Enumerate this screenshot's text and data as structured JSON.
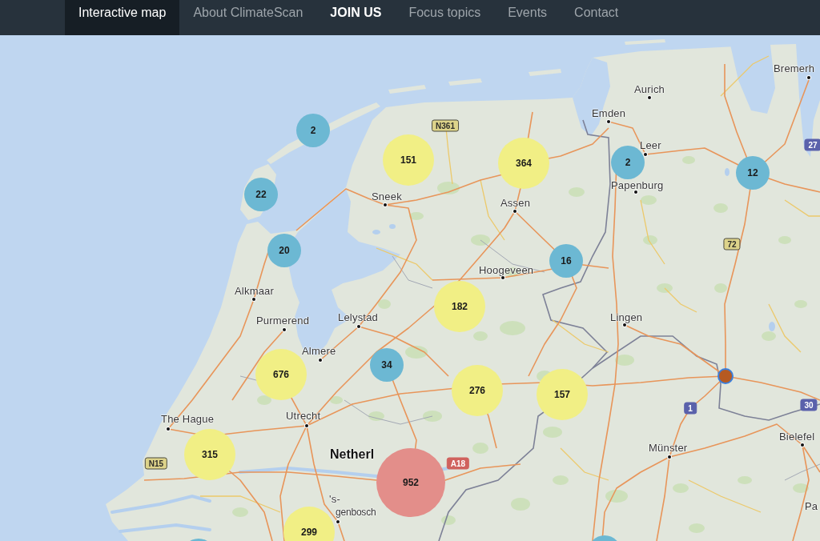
{
  "nav": {
    "items": [
      {
        "label": "Interactive map",
        "selected": true,
        "kind": "link"
      },
      {
        "label": "About ClimateScan",
        "selected": false,
        "kind": "link"
      },
      {
        "label": "JOIN US",
        "selected": false,
        "kind": "cta"
      },
      {
        "label": "Focus topics",
        "selected": false,
        "kind": "link"
      },
      {
        "label": "Events",
        "selected": false,
        "kind": "link"
      },
      {
        "label": "Contact",
        "selected": false,
        "kind": "link"
      }
    ]
  },
  "map": {
    "places": [
      {
        "name": "Bremerh",
        "kind": "city"
      },
      {
        "name": "Aurich",
        "kind": "city"
      },
      {
        "name": "Emden",
        "kind": "city"
      },
      {
        "name": "Leer",
        "kind": "city"
      },
      {
        "name": "Papenburg",
        "kind": "city"
      },
      {
        "name": "Sneek",
        "kind": "city"
      },
      {
        "name": "Assen",
        "kind": "city"
      },
      {
        "name": "Hoogeveen",
        "kind": "city"
      },
      {
        "name": "Alkmaar",
        "kind": "city"
      },
      {
        "name": "Purmerend",
        "kind": "city"
      },
      {
        "name": "Lelystad",
        "kind": "city"
      },
      {
        "name": "Lingen",
        "kind": "city"
      },
      {
        "name": "Almere",
        "kind": "city"
      },
      {
        "name": "The Hague",
        "kind": "city"
      },
      {
        "name": "Utrecht",
        "kind": "city"
      },
      {
        "name": "Bielefel",
        "kind": "city"
      },
      {
        "name": "Netherl",
        "kind": "country"
      },
      {
        "name": "Münster",
        "kind": "city"
      },
      {
        "name": "'s-",
        "kind": "text"
      },
      {
        "name": "genbosch",
        "kind": "city"
      },
      {
        "name": "Pa",
        "kind": "text"
      }
    ],
    "road_signs": [
      {
        "label": "N361",
        "kind": "regional"
      },
      {
        "label": "27",
        "kind": "autobahn"
      },
      {
        "label": "72",
        "kind": "regional"
      },
      {
        "label": "30",
        "kind": "autobahn"
      },
      {
        "label": "1",
        "kind": "autobahn"
      },
      {
        "label": "N15",
        "kind": "regional"
      },
      {
        "label": "A18",
        "kind": "motorway"
      }
    ],
    "markers": [
      {
        "kind": "cluster-small",
        "count": "2"
      },
      {
        "kind": "cluster-medium",
        "count": "151"
      },
      {
        "kind": "cluster-medium",
        "count": "364"
      },
      {
        "kind": "cluster-small",
        "count": "2"
      },
      {
        "kind": "cluster-small",
        "count": "12"
      },
      {
        "kind": "cluster-small",
        "count": "22"
      },
      {
        "kind": "cluster-small",
        "count": "20"
      },
      {
        "kind": "cluster-small",
        "count": "16"
      },
      {
        "kind": "cluster-medium",
        "count": "182"
      },
      {
        "kind": "cluster-medium",
        "count": "676"
      },
      {
        "kind": "cluster-small",
        "count": "34"
      },
      {
        "kind": "cluster-medium",
        "count": "276"
      },
      {
        "kind": "cluster-medium",
        "count": "157"
      },
      {
        "kind": "point"
      },
      {
        "kind": "cluster-medium",
        "count": "315"
      },
      {
        "kind": "cluster-small"
      },
      {
        "kind": "cluster-medium",
        "count": "299"
      },
      {
        "kind": "cluster-large",
        "count": "952"
      },
      {
        "kind": "cluster-small"
      }
    ]
  }
}
